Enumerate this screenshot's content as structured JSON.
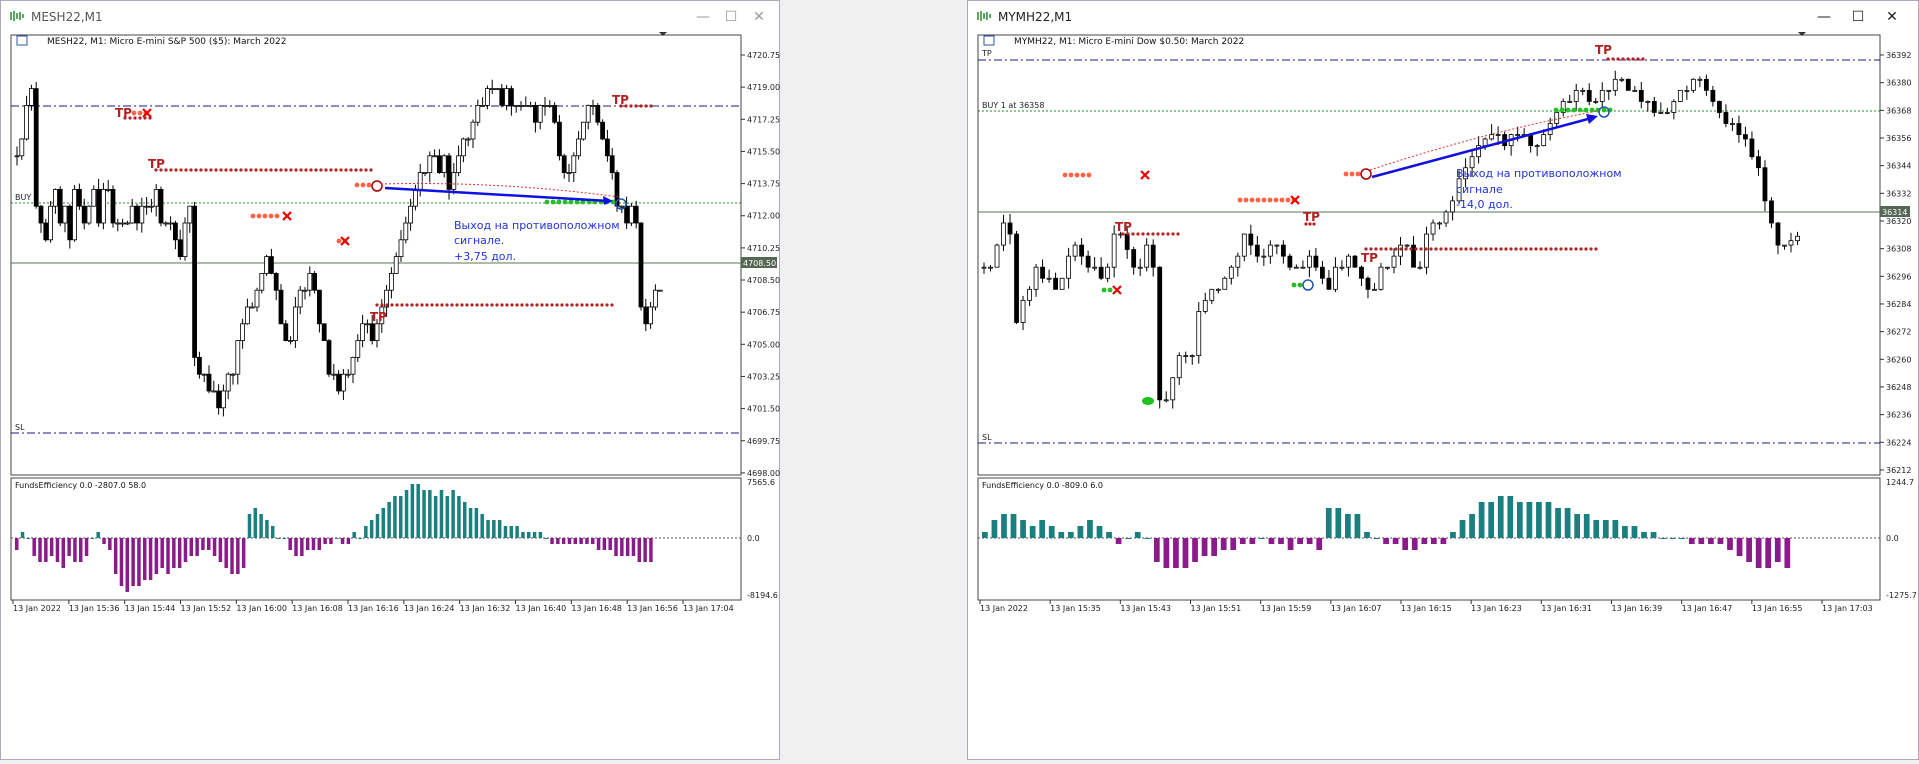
{
  "windows": [
    {
      "title": "MESH22,M1",
      "symbol_info": "MESH22, M1:  Micro E-mini S&P 500 ($5): March 2022",
      "price_labels": [
        "4720.75",
        "4719.00",
        "4717.25",
        "4715.50",
        "4713.75",
        "4712.00",
        "4710.25",
        "4708.50",
        "4706.75",
        "4705.00",
        "4703.25",
        "4701.50",
        "4699.75",
        "4698.00"
      ],
      "current_price": "4708.50",
      "time_labels": [
        "13 Jan 2022",
        "13 Jan 15:36",
        "13 Jan 15:44",
        "13 Jan 15:52",
        "13 Jan 16:00",
        "13 Jan 16:08",
        "13 Jan 16:16",
        "13 Jan 16:24",
        "13 Jan 16:32",
        "13 Jan 16:40",
        "13 Jan 16:48",
        "13 Jan 16:56",
        "13 Jan 17:04"
      ],
      "line_labels": {
        "buy": "BUY ",
        "sl": "SL",
        "tp": ""
      },
      "tp_marks": [
        "TP",
        "TP",
        "TP",
        "TP"
      ],
      "annotation": [
        "Выход на противоположном",
        "сигнале.",
        "+3,75 дол."
      ],
      "indicator_label": "FundsEfficiency 0.0 -2807.0 58.0",
      "indicator_scale": [
        "7565.6",
        "0.0",
        "-8194.6"
      ]
    },
    {
      "title": "MYMH22,M1",
      "symbol_info": "MYMH22, M1:  Micro E-mini Dow $0.50: March 2022",
      "price_labels": [
        "36392",
        "36380",
        "36368",
        "36356",
        "36344",
        "36332",
        "36320",
        "36308",
        "36296",
        "36284",
        "36272",
        "36260",
        "36248",
        "36236",
        "36224",
        "36212"
      ],
      "current_price": "36314",
      "time_labels": [
        "13 Jan 2022",
        "13 Jan 15:35",
        "13 Jan 15:43",
        "13 Jan 15:51",
        "13 Jan 15:59",
        "13 Jan 16:07",
        "13 Jan 16:15",
        "13 Jan 16:23",
        "13 Jan 16:31",
        "13 Jan 16:39",
        "13 Jan 16:47",
        "13 Jan 16:55",
        "13 Jan 17:03"
      ],
      "line_labels": {
        "buy": "BUY 1 at 36358",
        "sl": "SL",
        "tp": "TP"
      },
      "tp_marks": [
        "TP",
        "TP",
        "TP",
        "TP"
      ],
      "annotation": [
        "Выход на противоположном",
        "сигнале",
        "-14,0 дол."
      ],
      "indicator_label": "FundsEfficiency 0.0 -809.0 6.0",
      "indicator_scale": [
        "1244.7",
        "0.0",
        "-1275.7"
      ]
    }
  ],
  "colors": {
    "bull_hist": "#1a7f7f",
    "bear_hist": "#8b1a8b",
    "tp_red": "#b22222",
    "entry_orange": "#ff6347",
    "exit_green": "#22c022",
    "arrow_blue": "#1010e0",
    "annotation_blue": "#2233dd",
    "level_line": "#1a1a8a",
    "buy_line": "#228822"
  },
  "icons": [
    "chart-window-icon",
    "minimize-icon",
    "maximize-icon",
    "close-icon"
  ]
}
